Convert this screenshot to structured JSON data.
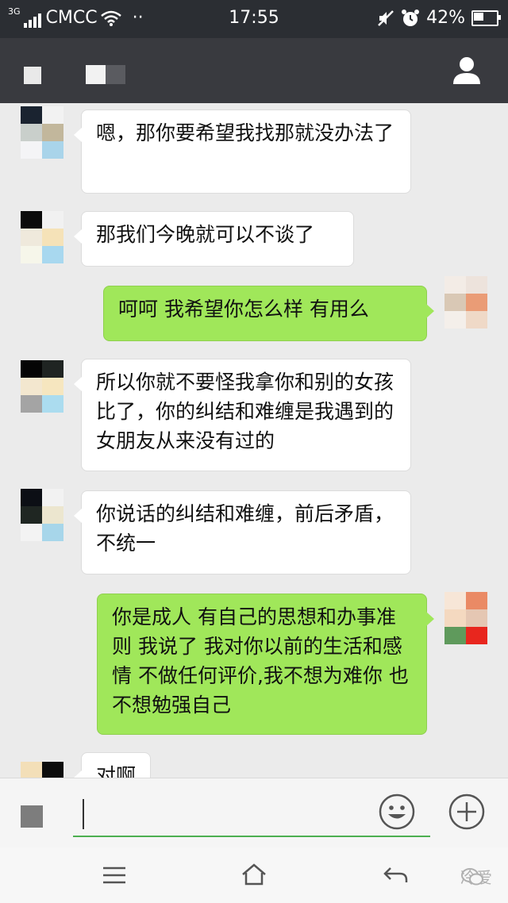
{
  "status_bar": {
    "network": "3G",
    "carrier": "CMCC",
    "dots": "··",
    "time": "17:55",
    "battery": "42%"
  },
  "messages": [
    {
      "side": "in",
      "text": "嗯，那你要希望我找那就没办法了"
    },
    {
      "side": "in",
      "text": "那我们今晚就可以不谈了"
    },
    {
      "side": "out",
      "text": "呵呵  我希望你怎么样 有用么"
    },
    {
      "side": "in",
      "text": "所以你就不要怪我拿你和别的女孩比了，你的纠结和难缠是我遇到的女朋友从来没有过的"
    },
    {
      "side": "in",
      "text": "你说话的纠结和难缠，前后矛盾，不统一"
    },
    {
      "side": "out",
      "text": "你是成人 有自己的思想和办事准则 我说了 我对你以前的生活和感情 不做任何评价,我不想为难你 也不想勉强自己"
    },
    {
      "side": "in",
      "text": "对啊"
    }
  ],
  "watermark": "冷爱",
  "colors": {
    "header": "#393a3f",
    "outgoing_bubble": "#a0e75a",
    "incoming_bubble": "#ffffff"
  }
}
